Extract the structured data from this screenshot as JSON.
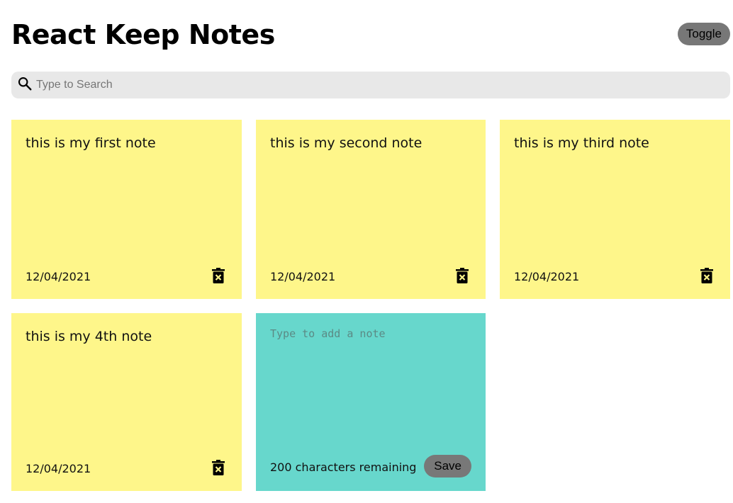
{
  "header": {
    "title": "React Keep Notes",
    "toggle_label": "Toggle"
  },
  "search": {
    "placeholder": "Type to Search",
    "value": "",
    "icon": "search-icon"
  },
  "notes": [
    {
      "text": "this is my first note",
      "date": "12/04/2021",
      "delete_icon": "delete-icon"
    },
    {
      "text": "this is my second note",
      "date": "12/04/2021",
      "delete_icon": "delete-icon"
    },
    {
      "text": "this is my third note",
      "date": "12/04/2021",
      "delete_icon": "delete-icon"
    },
    {
      "text": "this is my 4th note",
      "date": "12/04/2021",
      "delete_icon": "delete-icon"
    }
  ],
  "new_note": {
    "placeholder": "Type to add a note",
    "value": "",
    "remaining_text": "200 characters remaining",
    "save_label": "Save"
  },
  "colors": {
    "note_bg": "#fef68a",
    "new_note_bg": "#67d7cc",
    "search_bg": "#e8e8e8",
    "button_bg": "#777777"
  }
}
